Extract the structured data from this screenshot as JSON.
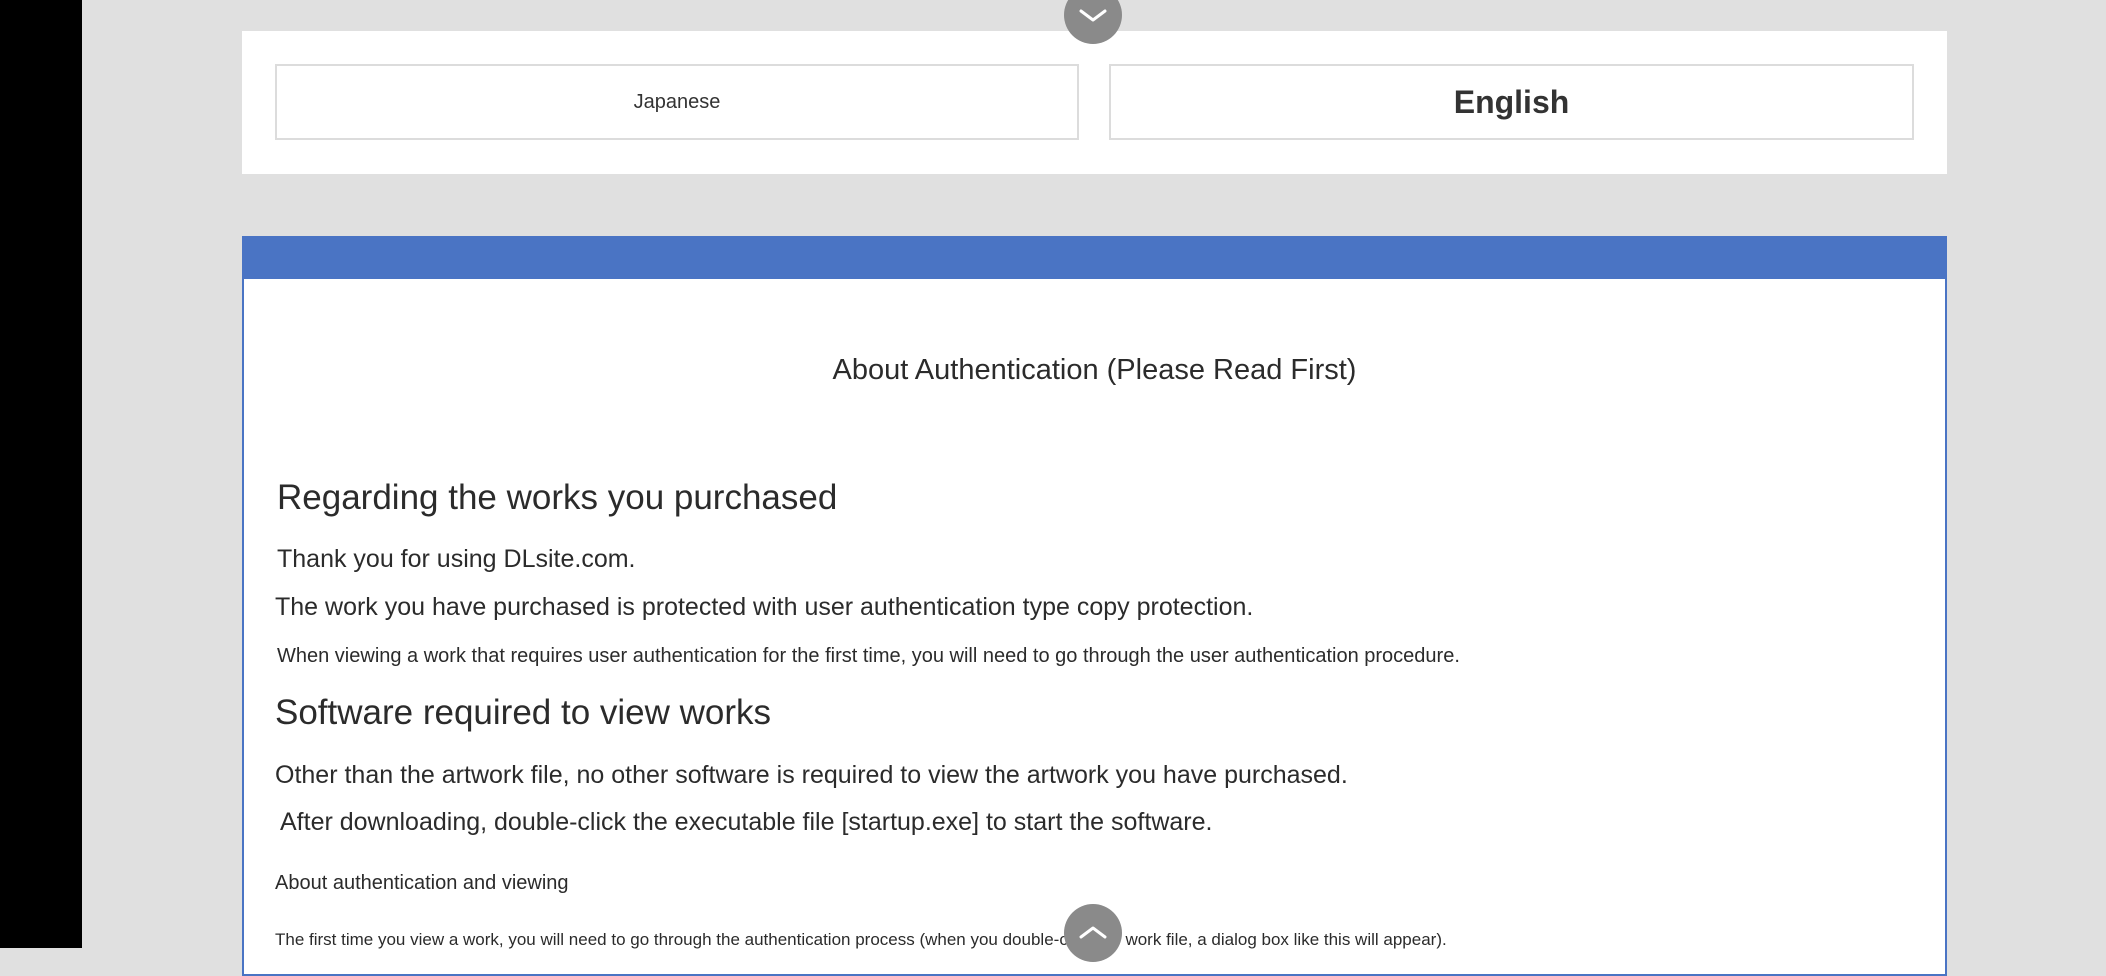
{
  "language_selector": {
    "japanese_label": "Japanese",
    "english_label": "English"
  },
  "document": {
    "title": "About Authentication (Please Read First)",
    "section1": {
      "heading": "Regarding the works you purchased",
      "line1": "Thank you for using DLsite.com.",
      "line2": "The work you have purchased is protected with user authentication type copy protection.",
      "line3": "When viewing a work that requires user authentication for the first time, you will need to go through the user authentication procedure."
    },
    "section2": {
      "heading": "Software required to view works",
      "line1": "Other than the artwork file, no other software is required to view the artwork you have purchased.",
      "line2": "After downloading, double-click the executable file [startup.exe] to start the software."
    },
    "section3": {
      "heading": "About authentication and viewing",
      "line1": "The first time you view a work, you will need to go through the authentication process (when you double-click the work file, a dialog box like this will appear)."
    }
  },
  "colors": {
    "accent": "#4a74c4",
    "background": "#e0e0e0",
    "toggle": "#8a8a8a"
  },
  "icons": {
    "top_toggle": "chevron-down-icon",
    "bottom_toggle": "chevron-up-icon"
  }
}
